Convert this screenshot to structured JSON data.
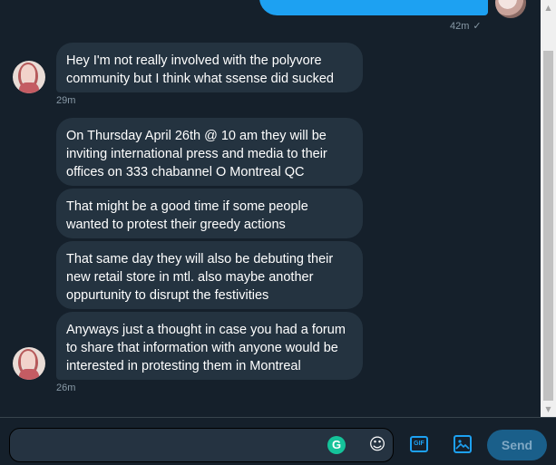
{
  "sent": {
    "time": "42m",
    "check": "✓"
  },
  "messages": [
    {
      "text": "Hey I'm not really involved with the polyvore community but I think what ssense did sucked",
      "time": "29m"
    },
    {
      "text": "On Thursday April 26th @ 10 am they will be inviting international press and media to their offices on 333 chabannel O Montreal QC"
    },
    {
      "text": "That might be a good time if some people wanted to protest their greedy actions"
    },
    {
      "text": "That same day they will also be debuting their new retail store in mtl. also maybe another oppurtunity to disrupt the festivities"
    },
    {
      "text": "Anyways just a thought in case you had a forum to share that information with anyone would be interested in protesting them in Montreal",
      "time": "26m"
    }
  ],
  "composer": {
    "placeholder": "",
    "grammarly_icon": "G",
    "emoji_icon": "☺",
    "gif_label": "GIF",
    "send_label": "Send"
  },
  "scrollbar": {
    "up": "▲",
    "down": "▼"
  }
}
